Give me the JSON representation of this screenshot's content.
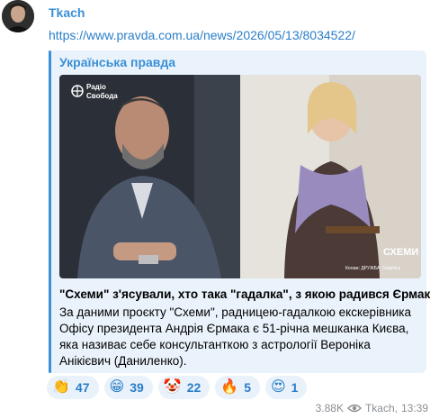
{
  "message": {
    "sender": "Tkach",
    "link": "https://www.pravda.com.ua/news/2026/05/13/8034522/"
  },
  "preview": {
    "site_name": "Українська правда",
    "title": "\"Схеми\" з'ясували, хто така \"гадалка\", з якою радився Єрмак",
    "description": "За даними проєкту \"Схеми\", радницею-гадалкою екскерівника Офісу президента Андрія Єрмака є 51-річна мешканка Києва, яка називає себе консультанткою з астрології Вероніка Анікієвич (Даниленко).",
    "image": {
      "logo_line1": "Радіо",
      "logo_line2": "Свобода",
      "badge": "СХЕМИ",
      "credit": "Колаж: ДРУЖБА, Graphics"
    }
  },
  "reactions": [
    {
      "emoji": "👏",
      "icon": "clap-icon",
      "count": "47"
    },
    {
      "emoji": "😁",
      "icon": "grin-icon",
      "count": "39"
    },
    {
      "emoji": "🤡",
      "icon": "clown-icon",
      "count": "22"
    },
    {
      "emoji": "🔥",
      "icon": "fire-icon",
      "count": "5"
    },
    {
      "emoji": "😍",
      "icon": "heart-eyes-icon",
      "count": "1"
    }
  ],
  "meta": {
    "views": "3.88K",
    "author": "Tkach,",
    "time": "13:39"
  },
  "colors": {
    "accent": "#3a8fd6",
    "preview_bg": "#eaf3fb",
    "reaction_bg": "#e9f2fa",
    "meta_text": "#8a8f94"
  }
}
